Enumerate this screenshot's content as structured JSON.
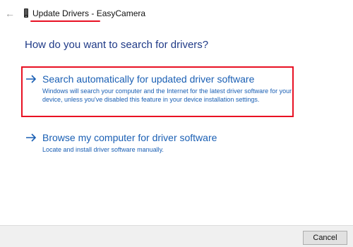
{
  "window": {
    "back_icon": "back-arrow-icon",
    "device_icon": "device-icon",
    "title_part1": "Update Drivers - ",
    "title_part2": "EasyCamera"
  },
  "main": {
    "heading": "How do you want to search for drivers?",
    "options": [
      {
        "icon": "arrow-right-icon",
        "title": "Search automatically for updated driver software",
        "description": "Windows will search your computer and the Internet for the latest driver software for your device, unless you've disabled this feature in your device installation settings."
      },
      {
        "icon": "arrow-right-icon",
        "title": "Browse my computer for driver software",
        "description": "Locate and install driver software manually."
      }
    ]
  },
  "footer": {
    "cancel_label": "Cancel"
  },
  "colors": {
    "heading": "#1f3a87",
    "link": "#1a5fb4",
    "highlight": "#e81123",
    "footer_bg": "#f0f0f0"
  }
}
